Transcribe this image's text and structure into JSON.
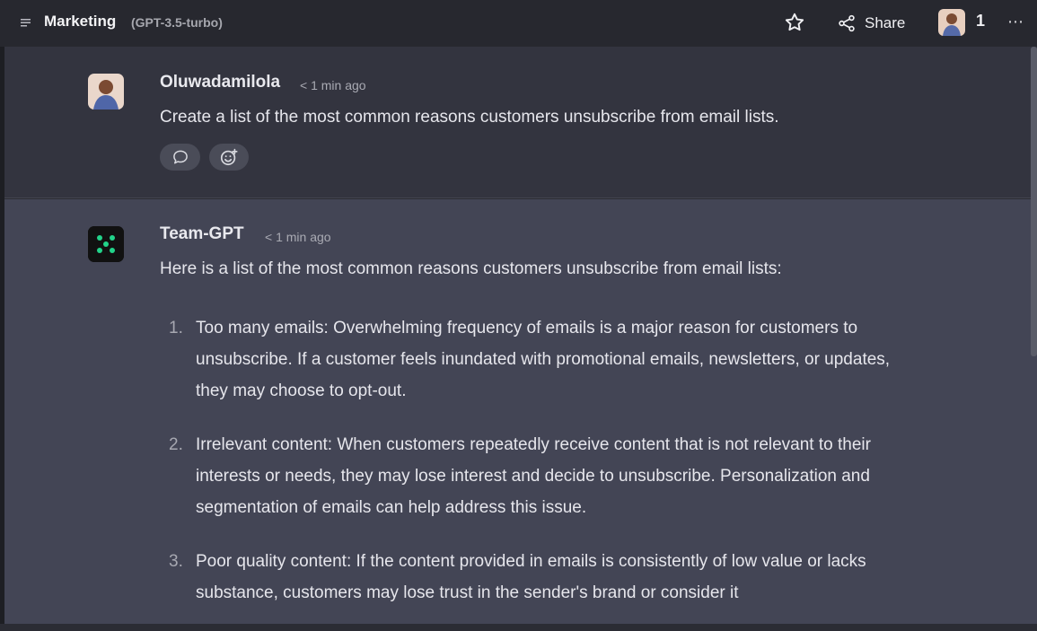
{
  "header": {
    "title": "Marketing",
    "model": "(GPT-3.5-turbo)",
    "share_label": "Share",
    "participants_count": "1",
    "more_label": "⋯"
  },
  "messages": [
    {
      "author": "Oluwadamilola",
      "time": "< 1 min ago",
      "text": "Create a list of the most common reasons customers unsubscribe from email lists."
    },
    {
      "author": "Team-GPT",
      "time": "< 1 min ago",
      "intro": "Here is a list of the most common reasons customers unsubscribe from email lists:",
      "items": [
        {
          "num": "1.",
          "text": "Too many emails: Overwhelming frequency of emails is a major reason for customers to unsubscribe. If a customer feels inundated with promotional emails, newsletters, or updates, they may choose to opt-out."
        },
        {
          "num": "2.",
          "text": "Irrelevant content: When customers repeatedly receive content that is not relevant to their interests or needs, they may lose interest and decide to unsubscribe. Personalization and segmentation of emails can help address this issue."
        },
        {
          "num": "3.",
          "text": "Poor quality content: If the content provided in emails is consistently of low value or lacks substance, customers may lose trust in the sender's brand or consider it"
        }
      ]
    }
  ],
  "colors": {
    "accent_green": "#22d38a",
    "topbar": "#27282f",
    "user_bg": "#33343f",
    "ai_bg": "#434555"
  },
  "icons": [
    "menu-icon",
    "star-icon",
    "share-icon",
    "more-icon",
    "comment-icon",
    "add-reaction-icon"
  ]
}
